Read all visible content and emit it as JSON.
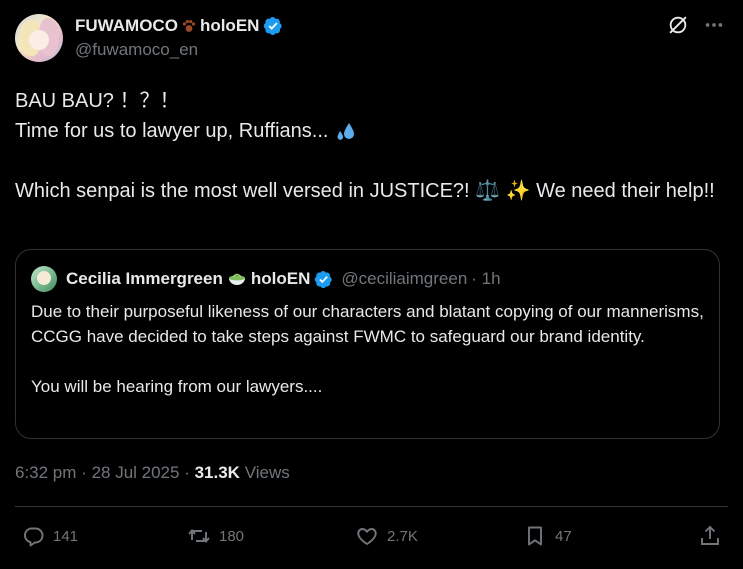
{
  "author": {
    "display_name": "FUWAMOCO",
    "name_suffix": "holoEN",
    "handle": "@fuwamoco_en",
    "verified_color": "#1d9bf0"
  },
  "tweet": {
    "line1": "BAU BAU? ！？！",
    "line2": "Time for us to lawyer up, Ruffians...",
    "line3": "Which senpai is the most well versed in JUSTICE?! ⚖️ ✨ We need their help!!"
  },
  "quote": {
    "display_name": "Cecilia Immergreen",
    "name_suffix": "holoEN",
    "handle": "@ceciliaimgreen",
    "time": "· 1h",
    "text1": "Due to their purposeful likeness of our characters and blatant copying of our mannerisms, CCGG have decided to take steps against FWMC to safeguard our brand identity.",
    "text2": "You will be hearing from our lawyers...."
  },
  "meta": {
    "time": "6:32 pm",
    "date": "28 Jul 2025",
    "views_count": "31.3K",
    "views_label": "Views"
  },
  "actions": {
    "replies": "141",
    "reposts": "180",
    "likes": "2.7K",
    "bookmarks": "47"
  },
  "icons": {
    "grok": "grok-icon",
    "more": "more-icon",
    "reply": "reply-icon",
    "repost": "repost-icon",
    "like": "heart-icon",
    "bookmark": "bookmark-icon",
    "share": "share-icon"
  }
}
